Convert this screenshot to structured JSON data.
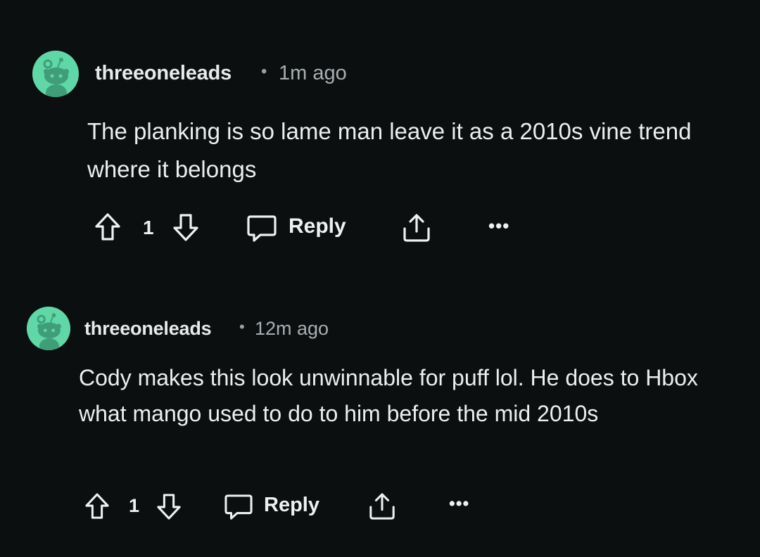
{
  "theme": {
    "background": "#0b0f10",
    "avatar_color": "#5fd7a6",
    "text_color": "#eceeef",
    "meta_color": "#a9aeb1"
  },
  "comments": [
    {
      "username": "threeoneleads",
      "separator": "•",
      "time": "1m ago",
      "avatar_icon": "snoo-avatar-icon",
      "body": "The planking is so lame man leave it as a 2010s vine trend where it belongs",
      "votes": "1",
      "reply_label": "Reply",
      "more_label": "•••",
      "icons": {
        "upvote": "upvote-arrow-icon",
        "downvote": "downvote-arrow-icon",
        "reply": "chat-bubble-icon",
        "share": "share-icon"
      }
    },
    {
      "username": "threeoneleads",
      "separator": "•",
      "time": "12m ago",
      "avatar_icon": "snoo-avatar-icon",
      "body": "Cody makes this look unwinnable for puff lol. He does to Hbox what mango used to do to him before the mid 2010s",
      "votes": "1",
      "reply_label": "Reply",
      "more_label": "•••",
      "icons": {
        "upvote": "upvote-arrow-icon",
        "downvote": "downvote-arrow-icon",
        "reply": "chat-bubble-icon",
        "share": "share-icon"
      }
    }
  ]
}
